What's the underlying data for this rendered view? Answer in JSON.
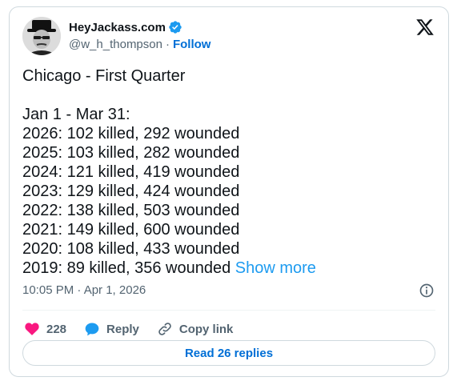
{
  "author": {
    "display_name": "HeyJackass.com",
    "handle": "@w_h_thompson",
    "separator": "·",
    "follow_label": "Follow"
  },
  "tweet": {
    "title": "Chicago - First Quarter",
    "subtitle": "Jan 1 - Mar 31:",
    "lines": [
      "2026: 102 killed, 292 wounded",
      "2025: 103 killed, 282 wounded",
      "2024: 121 killed, 419 wounded",
      "2023: 129 killed, 424 wounded",
      "2022: 138 killed, 503 wounded",
      "2021: 149 killed, 600 wounded",
      "2020: 108 killed, 433 wounded",
      "2019: 89 killed, 356 wounded"
    ],
    "show_more_label": "Show more",
    "timestamp": "10:05 PM · Apr 1, 2026"
  },
  "actions": {
    "like_count": "228",
    "reply_label": "Reply",
    "copy_link_label": "Copy link"
  },
  "read_replies_label": "Read 26 replies",
  "icons": [
    "verified-badge-icon",
    "x-logo-icon",
    "info-icon",
    "heart-icon",
    "reply-bubble-icon",
    "link-icon"
  ],
  "colors": {
    "link_blue": "#006fd6",
    "show_more_blue": "#1d9bf0",
    "heart_red": "#f91880",
    "reply_blue": "#1d9bf0",
    "muted_text": "#536471",
    "border": "#cfd9de"
  }
}
